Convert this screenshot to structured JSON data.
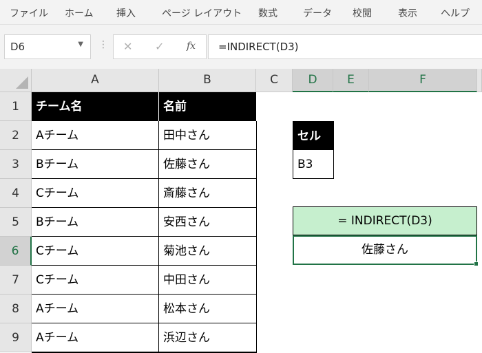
{
  "menu": [
    "ファイル",
    "ホーム",
    "挿入",
    "ページ レイアウト",
    "数式",
    "データ",
    "校閲",
    "表示",
    "ヘルプ"
  ],
  "namebox": {
    "value": "D6"
  },
  "formula_bar": {
    "fx": "fx",
    "value": "=INDIRECT(D3)"
  },
  "columns": [
    "A",
    "B",
    "C",
    "D",
    "E",
    "F"
  ],
  "rows": [
    "1",
    "2",
    "3",
    "4",
    "5",
    "6",
    "7",
    "8",
    "9"
  ],
  "table": {
    "headers": [
      "チーム名",
      "名前"
    ],
    "rows": [
      [
        "Aチーム",
        "田中さん"
      ],
      [
        "Bチーム",
        "佐藤さん"
      ],
      [
        "Cチーム",
        "斎藤さん"
      ],
      [
        "Bチーム",
        "安西さん"
      ],
      [
        "Cチーム",
        "菊池さん"
      ],
      [
        "Cチーム",
        "中田さん"
      ],
      [
        "Aチーム",
        "松本さん"
      ],
      [
        "Aチーム",
        "浜辺さん"
      ]
    ]
  },
  "ref_box": {
    "header": "セル",
    "value": "B3"
  },
  "formula_box": {
    "label": "= INDIRECT(D3)",
    "result": "佐藤さん"
  },
  "colors": {
    "accent": "#217346",
    "formula_fill": "#c6efce",
    "header_fill": "#000000"
  }
}
